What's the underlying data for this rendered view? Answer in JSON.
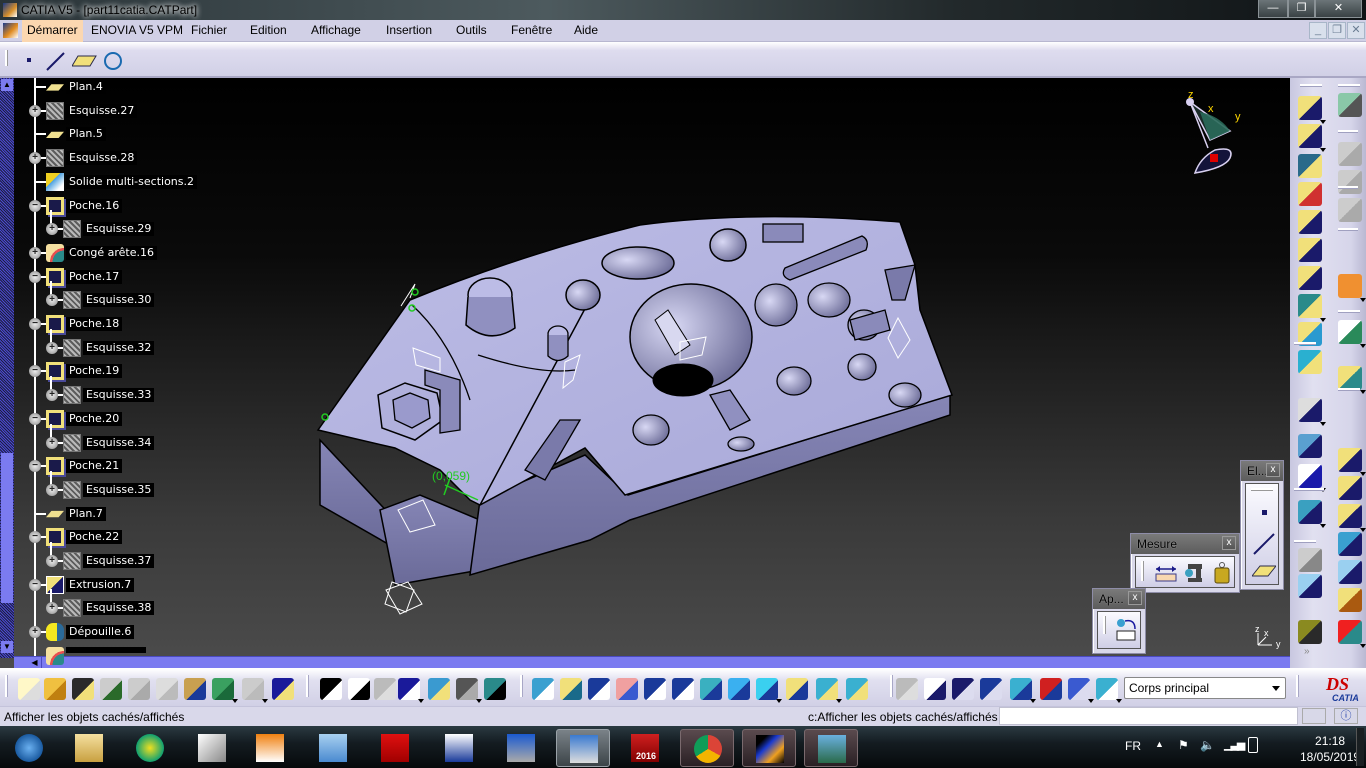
{
  "window": {
    "title": "CATIA V5 - [part11catia.CATPart]",
    "controls": {
      "minimize": "—",
      "restore": "❐",
      "close": "✕"
    }
  },
  "menubar": {
    "items": [
      "Démarrer",
      "ENOVIA V5 VPM",
      "Fichier",
      "Edition",
      "Affichage",
      "Insertion",
      "Outils",
      "Fenêtre",
      "Aide"
    ],
    "active": "Démarrer",
    "doc_controls": {
      "minimize": "_",
      "restore": "❐",
      "close": "✕"
    }
  },
  "top_toolbar": {
    "icons": [
      "point-icon",
      "line-icon",
      "plane-icon",
      "circle-icon"
    ]
  },
  "tree": {
    "nodes": [
      {
        "label": "Plan.4",
        "icon": "plane",
        "level": 0,
        "expander": ""
      },
      {
        "label": "Esquisse.27",
        "icon": "sketch",
        "level": 0,
        "expander": "+"
      },
      {
        "label": "Plan.5",
        "icon": "plane",
        "level": 0,
        "expander": ""
      },
      {
        "label": "Esquisse.28",
        "icon": "sketch",
        "level": 0,
        "expander": "+"
      },
      {
        "label": "Solide multi-sections.2",
        "icon": "solid",
        "level": 0,
        "expander": ""
      },
      {
        "label": "Poche.16",
        "icon": "pocket",
        "level": 0,
        "expander": "−"
      },
      {
        "label": "Esquisse.29",
        "icon": "sketch",
        "level": 1,
        "expander": "+"
      },
      {
        "label": "Congé arête.16",
        "icon": "fillet",
        "level": 0,
        "expander": "+"
      },
      {
        "label": "Poche.17",
        "icon": "pocket",
        "level": 0,
        "expander": "−"
      },
      {
        "label": "Esquisse.30",
        "icon": "sketch",
        "level": 1,
        "expander": "+"
      },
      {
        "label": "Poche.18",
        "icon": "pocket",
        "level": 0,
        "expander": "−"
      },
      {
        "label": "Esquisse.32",
        "icon": "sketch",
        "level": 1,
        "expander": "+"
      },
      {
        "label": "Poche.19",
        "icon": "pocket",
        "level": 0,
        "expander": "−"
      },
      {
        "label": "Esquisse.33",
        "icon": "sketch",
        "level": 1,
        "expander": "+"
      },
      {
        "label": "Poche.20",
        "icon": "pocket",
        "level": 0,
        "expander": "−"
      },
      {
        "label": "Esquisse.34",
        "icon": "sketch",
        "level": 1,
        "expander": "+"
      },
      {
        "label": "Poche.21",
        "icon": "pocket",
        "level": 0,
        "expander": "−"
      },
      {
        "label": "Esquisse.35",
        "icon": "sketch",
        "level": 1,
        "expander": "+"
      },
      {
        "label": "Plan.7",
        "icon": "plane",
        "level": 0,
        "expander": ""
      },
      {
        "label": "Poche.22",
        "icon": "pocket",
        "level": 0,
        "expander": "−"
      },
      {
        "label": "Esquisse.37",
        "icon": "sketch",
        "level": 1,
        "expander": "+"
      },
      {
        "label": "Extrusion.7",
        "icon": "extr",
        "level": 0,
        "expander": "−"
      },
      {
        "label": "Esquisse.38",
        "icon": "sketch",
        "level": 1,
        "expander": "+"
      },
      {
        "label": "Dépouille.6",
        "icon": "draft",
        "level": 0,
        "expander": "+"
      }
    ]
  },
  "viewport": {
    "annotation": "(0,059)",
    "compass_labels": {
      "z": "z",
      "x": "x",
      "y": "y"
    },
    "mini_axis": {
      "z": "z",
      "x": "x",
      "y": "y"
    },
    "colors": {
      "part_face": "#b4b4e0",
      "part_dark": "#7a7aa8",
      "edge": "#000000",
      "annotation": "#22cc22"
    }
  },
  "floating_toolbars": {
    "elements": {
      "title": "El...",
      "close": "x",
      "icons": [
        "point-icon",
        "line-icon",
        "plane-icon"
      ]
    },
    "mesure": {
      "title": "Mesure",
      "close": "x",
      "icons": [
        "measure-between-icon",
        "measure-item-icon",
        "measure-inertia-icon"
      ]
    },
    "apply": {
      "title": "Ap...",
      "close": "x",
      "icons": [
        "apply-material-icon"
      ]
    }
  },
  "bottom_toolbar": {
    "icons": [
      "new-icon",
      "open-icon",
      "save-icon",
      "print-icon",
      "cut-icon",
      "copy-icon",
      "paste-icon",
      "undo-icon",
      "redo-icon",
      "whats-this-icon",
      "formula-icon",
      "comment-icon",
      "link-icon",
      "table-icon",
      "tree-icon",
      "lock-icon",
      "parameters-icon",
      "fly-mode-icon",
      "fit-all-icon",
      "pan-icon",
      "rotate-icon",
      "zoom-in-icon",
      "zoom-out-icon",
      "normal-view-icon",
      "multi-view-icon",
      "iso-view-icon",
      "shading-icon",
      "hide-show-icon",
      "swap-visible-icon",
      "update-icon",
      "manipulation-icon",
      "axis-system-icon",
      "numeric-icon",
      "quick-view-icon",
      "constraint-icon",
      "layer-icon",
      "body-icon"
    ],
    "body_select": "Corps principal",
    "catia_logo": "CATIA"
  },
  "statusbar": {
    "message": "Afficher les objets cachés/affichés",
    "command_prompt": "c:Afficher les objets cachés/affichés",
    "command_value": ""
  },
  "taskbar": {
    "apps": [
      "start-orb",
      "explorer",
      "app-green",
      "3ds-launcher",
      "vlc",
      "calculator",
      "e3-app",
      "media-player-classic",
      "remote-desktop",
      "keyboard-screen",
      "solidworks-2016",
      "chrome",
      "catia",
      "photo-viewer"
    ],
    "active": [
      "keyboard-screen",
      "catia"
    ],
    "solidworks_label": "2016",
    "lang": "FR",
    "time": "21:18",
    "date": "18/05/2019"
  }
}
